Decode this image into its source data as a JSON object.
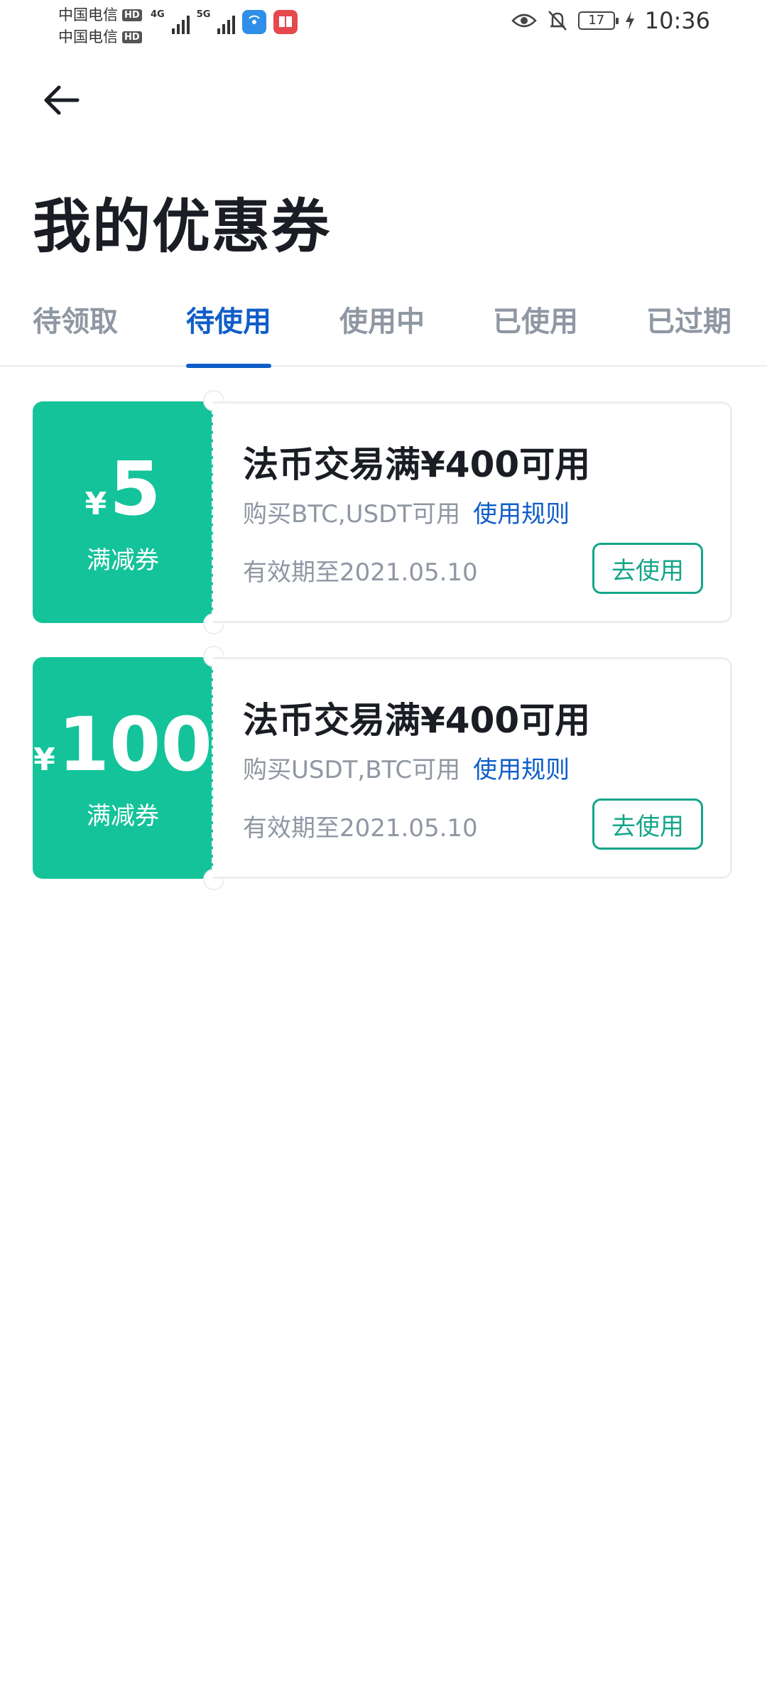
{
  "status_bar": {
    "carrier_1": "中国电信",
    "carrier_2": "中国电信",
    "hd_badge": "HD",
    "net_1": "4G",
    "net_2": "5G",
    "battery": "17",
    "time": "10:36"
  },
  "header": {
    "title": "我的优惠券"
  },
  "tabs": [
    {
      "label": "待领取",
      "active": false
    },
    {
      "label": "待使用",
      "active": true
    },
    {
      "label": "使用中",
      "active": false
    },
    {
      "label": "已使用",
      "active": false
    },
    {
      "label": "已过期",
      "active": false
    }
  ],
  "coupons": [
    {
      "currency": "¥",
      "amount": "5",
      "type": "满减券",
      "title": "法币交易满¥400可用",
      "subtitle": "购买BTC,USDT可用",
      "rule_link": "使用规则",
      "expiry": "有效期至2021.05.10",
      "button": "去使用"
    },
    {
      "currency": "¥",
      "amount": "100",
      "type": "满减券",
      "title": "法币交易满¥400可用",
      "subtitle": "购买USDT,BTC可用",
      "rule_link": "使用规则",
      "expiry": "有效期至2021.05.10",
      "button": "去使用"
    }
  ],
  "colors": {
    "accent_blue": "#0f5ec8",
    "coupon_green": "#14c39a",
    "button_green": "#14a589",
    "muted_text": "#8f97a3"
  }
}
